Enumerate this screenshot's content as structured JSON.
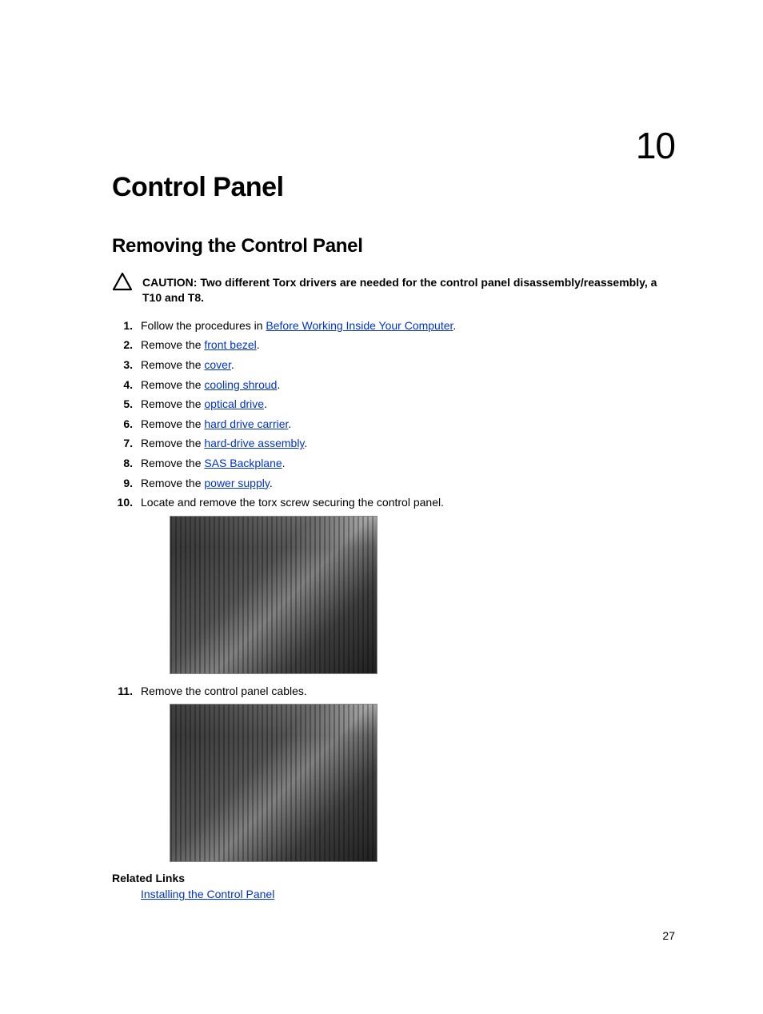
{
  "chapter": {
    "number": "10",
    "title": "Control Panel"
  },
  "section": {
    "title": "Removing the Control Panel"
  },
  "caution": {
    "label": "CAUTION: Two different Torx drivers are needed for the control panel disassembly/reassembly, a T10 and T8."
  },
  "steps": [
    {
      "pre": "Follow the procedures in ",
      "link": "Before Working Inside Your Computer",
      "post": "."
    },
    {
      "pre": "Remove the ",
      "link": "front bezel",
      "post": "."
    },
    {
      "pre": "Remove the ",
      "link": "cover",
      "post": "."
    },
    {
      "pre": "Remove the ",
      "link": "cooling shroud",
      "post": "."
    },
    {
      "pre": "Remove the ",
      "link": "optical drive",
      "post": "."
    },
    {
      "pre": "Remove the ",
      "link": "hard drive carrier",
      "post": "."
    },
    {
      "pre": "Remove the ",
      "link": "hard-drive assembly",
      "post": "."
    },
    {
      "pre": "Remove the ",
      "link": "SAS Backplane",
      "post": "."
    },
    {
      "pre": "Remove the ",
      "link": "power supply",
      "post": "."
    },
    {
      "pre": "Locate and remove the torx screw securing the control panel.",
      "link": null,
      "post": "",
      "image": "a"
    },
    {
      "pre": "Remove the control panel cables.",
      "link": null,
      "post": "",
      "image": "b"
    }
  ],
  "related": {
    "heading": "Related Links",
    "links": [
      {
        "label": "Installing the Control Panel"
      }
    ]
  },
  "page": {
    "number": "27"
  }
}
